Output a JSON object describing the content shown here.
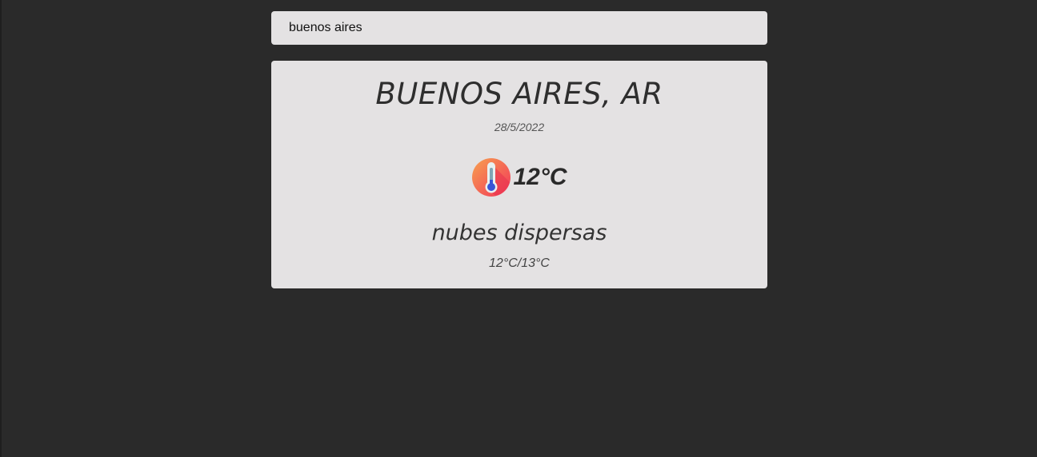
{
  "search": {
    "value": "buenos aires"
  },
  "weather": {
    "city": "BUENOS AIRES, AR",
    "date": "28/5/2022",
    "icon": "thermometer-icon",
    "temperature": "12°C",
    "description": "nubes dispersas",
    "min_max": "12°C/13°C"
  },
  "colors": {
    "background": "#2a2a2a",
    "card": "#e4e2e3",
    "icon_gradient_start": "#f7a14f",
    "icon_gradient_end": "#f2365a"
  }
}
